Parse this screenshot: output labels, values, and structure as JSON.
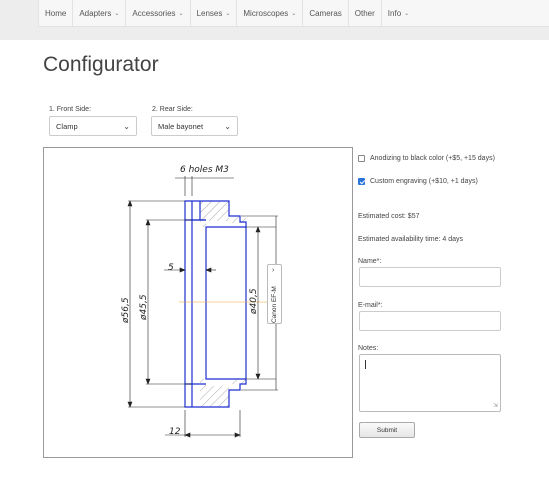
{
  "nav": {
    "items": [
      {
        "label": "Home",
        "dropdown": false
      },
      {
        "label": "Adapters",
        "dropdown": true
      },
      {
        "label": "Accessories",
        "dropdown": true
      },
      {
        "label": "Lenses",
        "dropdown": true
      },
      {
        "label": "Microscopes",
        "dropdown": true
      },
      {
        "label": "Cameras",
        "dropdown": false
      },
      {
        "label": "Other",
        "dropdown": false
      },
      {
        "label": "Info",
        "dropdown": true
      }
    ]
  },
  "page": {
    "title": "Configurator"
  },
  "front_side": {
    "label": "1. Front Side:",
    "value": "Clamp"
  },
  "rear_side": {
    "label": "2. Rear Side:",
    "value": "Male bayonet"
  },
  "drawing": {
    "holes_label": "6 holes M3",
    "dim_outer": "ø56,5",
    "dim_inner": "ø45,5",
    "dim_bore": "ø40,5",
    "dim_5": "5",
    "dim_length": "12",
    "mount_label": "Canon EF-M",
    "colors": {
      "outline": "#1f2fd0",
      "dimension": "#222222",
      "axis": "#f0a030"
    }
  },
  "options": {
    "anodizing": {
      "label": "Anodizing to black color (+$5, +15 days)",
      "checked": false
    },
    "engraving": {
      "label": "Custom engraving (+$10, +1 days)",
      "checked": true
    }
  },
  "estimates": {
    "cost": "Estimated cost: $57",
    "availability": "Estimated availability time: 4 days"
  },
  "form": {
    "name_label": "Name*:",
    "email_label": "E-mail*:",
    "notes_label": "Notes:",
    "submit_label": "Submit"
  }
}
